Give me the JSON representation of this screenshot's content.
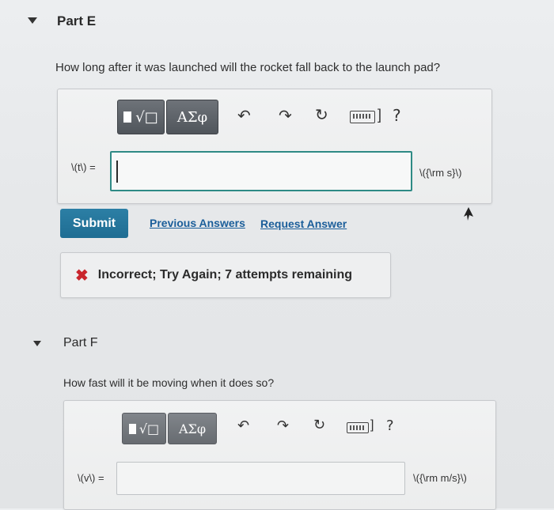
{
  "partE": {
    "title": "Part E",
    "question": "How long after it was launched will the rocket fall back to the launch pad?",
    "toolbar": {
      "templates_label": "√□",
      "symbols_label": "ΑΣφ",
      "undo_icon": "undo-icon",
      "redo_icon": "redo-icon",
      "reset_icon": "reset-icon",
      "keyboard_icon": "keyboard-icon",
      "help_label": "?"
    },
    "input_label": "\\(t\\) =",
    "input_value": "",
    "unit": "\\({\\rm s}\\)",
    "submit_label": "Submit",
    "previous_answers_label": "Previous Answers",
    "request_answer_label": "Request Answer",
    "feedback": {
      "icon": "✖",
      "text": "Incorrect; Try Again; 7 attempts remaining",
      "color": "#c9252c"
    }
  },
  "partF": {
    "title": "Part F",
    "question": "How fast will it be moving when it does so?",
    "toolbar": {
      "templates_label": "√□",
      "symbols_label": "ΑΣφ",
      "help_label": "?"
    },
    "input_label": "\\(v\\) =",
    "input_value": "",
    "unit": "\\({\\rm m/s}\\)"
  },
  "colors": {
    "accent": "#2e8a85",
    "submit": "#2277a0",
    "link": "#1b5e9a",
    "error": "#c9252c"
  }
}
